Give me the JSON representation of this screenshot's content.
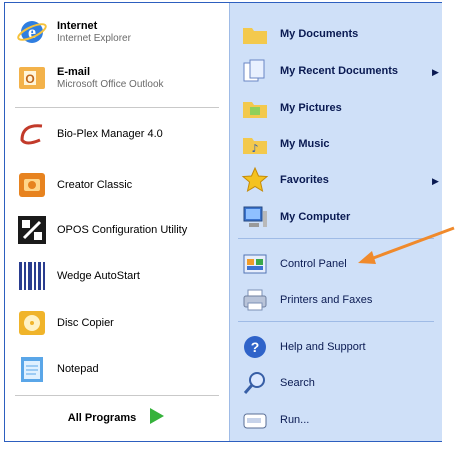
{
  "left_items": [
    {
      "title": "Internet",
      "subtitle": "Internet Explorer",
      "icon": "internet-explorer-icon",
      "bold": true
    },
    {
      "title": "E-mail",
      "subtitle": "Microsoft Office Outlook",
      "icon": "outlook-icon",
      "bold": true
    },
    {
      "title": "Bio-Plex Manager 4.0",
      "icon": "bioplex-icon"
    },
    {
      "title": "Creator Classic",
      "icon": "creator-classic-icon"
    },
    {
      "title": "OPOS Configuration Utility",
      "icon": "opos-config-icon"
    },
    {
      "title": "Wedge AutoStart",
      "icon": "barcode-icon"
    },
    {
      "title": "Disc Copier",
      "icon": "disc-copier-icon"
    },
    {
      "title": "Notepad",
      "icon": "notepad-icon"
    }
  ],
  "all_programs": {
    "label": "All Programs"
  },
  "right_items": [
    {
      "label": "My Documents",
      "icon": "folder-icon"
    },
    {
      "label": "My Recent Documents",
      "icon": "recent-docs-icon"
    },
    {
      "label": "My Pictures",
      "icon": "pictures-folder-icon"
    },
    {
      "label": "My Music",
      "icon": "music-folder-icon"
    },
    {
      "label": "Favorites",
      "icon": "star-icon"
    },
    {
      "label": "My Computer",
      "icon": "computer-icon"
    },
    {
      "label": "Control Panel",
      "icon": "control-panel-icon"
    },
    {
      "label": "Printers and Faxes",
      "icon": "printer-icon"
    },
    {
      "label": "Help and Support",
      "icon": "help-icon"
    },
    {
      "label": "Search",
      "icon": "search-icon"
    },
    {
      "label": "Run...",
      "icon": "run-icon"
    }
  ],
  "colors": {
    "pointer_arrow": "#f08a2c",
    "right_panel": "#cfe0f8",
    "frame_border": "#2d5fbf"
  }
}
